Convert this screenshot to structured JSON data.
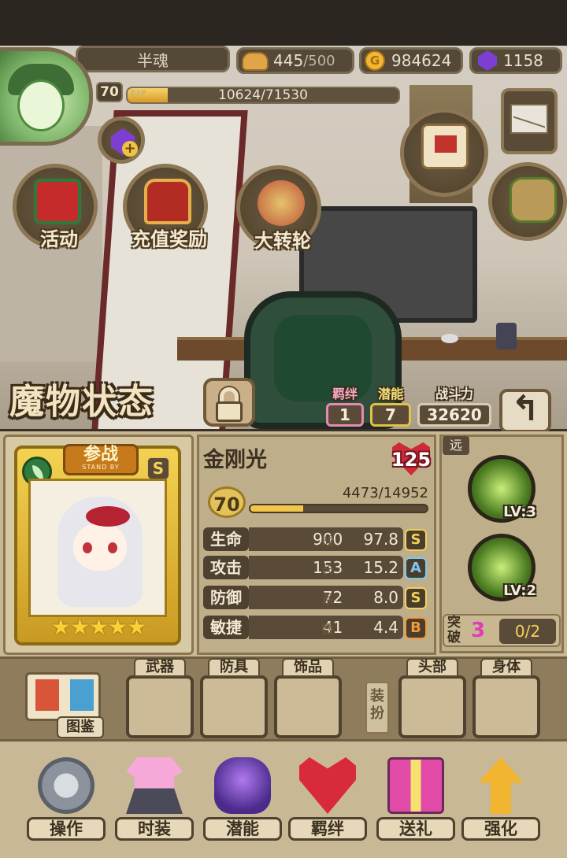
{
  "hud": {
    "player_name": "半魂",
    "stamina": "445",
    "stamina_max": "/500",
    "gold": "984624",
    "gems": "1158",
    "level": "70",
    "exp_tag": "EXP",
    "exp_text": "10624/71530",
    "exp_progress": 0.149
  },
  "events": {
    "activity_label": "活动",
    "recharge_label": "充值奖励",
    "wheel_label": "大转轮"
  },
  "monster_status": {
    "title": "魔物状态",
    "bond_label": "羁绊",
    "bond_value": "1",
    "potential_label": "潜能",
    "potential_value": "7",
    "power_label": "战斗力",
    "power_value": "32620",
    "back_icon": "↰"
  },
  "card": {
    "standby_cn": "参战",
    "standby_en": "STAND BY",
    "rank": "S",
    "stars": "★★★★★",
    "star_count": 5
  },
  "monster": {
    "name": "金刚光",
    "heart_value": "125",
    "level": "70",
    "xp_text": "4473/14952",
    "xp_progress": 0.299
  },
  "stats": [
    {
      "name": "生命",
      "value": "9005",
      "growth_label": "成",
      "growth": "97.8",
      "grade": "S",
      "grade_color": "#f2d25a"
    },
    {
      "name": "攻击",
      "value": "1536",
      "growth_label": "长",
      "growth": "15.2",
      "grade": "A",
      "grade_color": "#7ac8f2"
    },
    {
      "name": "防御",
      "value": "723",
      "growth_label": "系",
      "growth": "8.0",
      "grade": "S",
      "grade_color": "#f2d25a"
    },
    {
      "name": "敏捷",
      "value": "416",
      "growth_label": "数",
      "growth": "4.4",
      "grade": "B",
      "grade_color": "#f29a3a"
    }
  ],
  "skills": {
    "range_tag": "远",
    "skill1_lv": "LV:3",
    "skill2_lv": "LV:2",
    "breakthrough_label": "突破",
    "breakthrough_value": "3",
    "breakthrough_progress": "0/2"
  },
  "equipment": {
    "codex_label": "图鉴",
    "weapon": "武器",
    "armor": "防具",
    "accessory": "饰品",
    "dress_label": "装扮",
    "head": "头部",
    "body": "身体"
  },
  "actions": {
    "operate": "操作",
    "fashion": "时装",
    "potential": "潜能",
    "bond": "羁绊",
    "gift": "送礼",
    "upgrade": "强化"
  }
}
